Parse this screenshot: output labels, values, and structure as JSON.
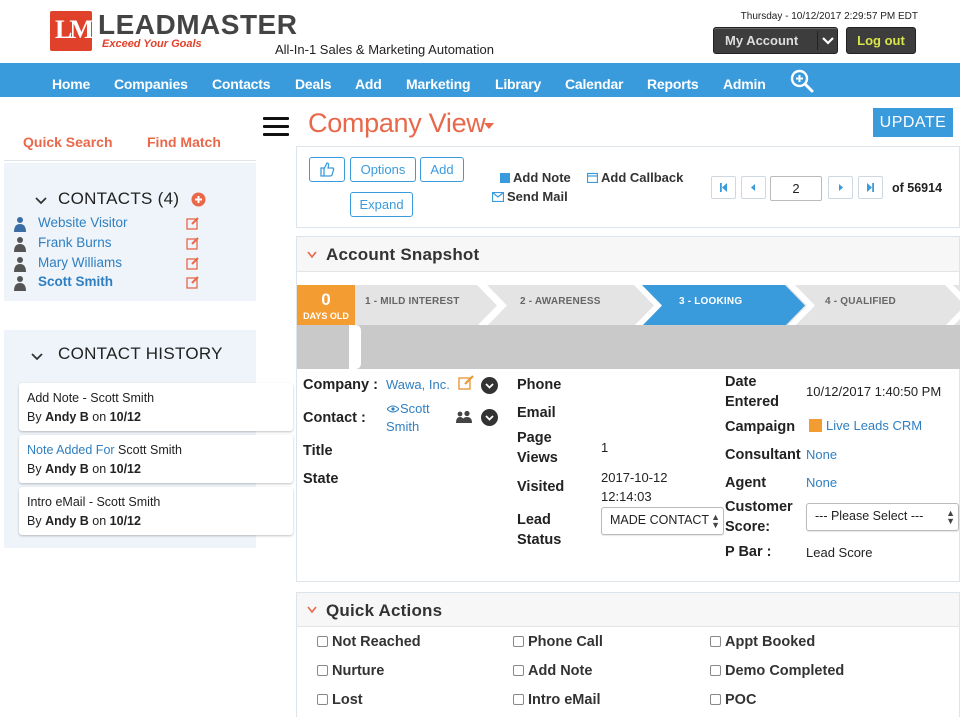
{
  "header": {
    "logo_name": "LEADMASTER",
    "logo_tagline": "Exceed Your Goals",
    "product_tagline": "All-In-1 Sales & Marketing Automation",
    "datetime": "Thursday - 10/12/2017 2:29:57 PM EDT",
    "my_account_label": "My Account",
    "logout_label": "Log out"
  },
  "nav": {
    "items": [
      "Home",
      "Companies",
      "Contacts",
      "Deals",
      "Add",
      "Marketing",
      "Library",
      "Calendar",
      "Reports",
      "Admin"
    ]
  },
  "sidebar": {
    "quick_search": "Quick Search",
    "find_match": "Find Match",
    "contacts_title": "CONTACTS (4)",
    "contacts": [
      "Website Visitor",
      "Frank Burns",
      "Mary Williams",
      "Scott Smith"
    ],
    "history_title": "CONTACT HISTORY",
    "history": [
      {
        "line1_prefix": "Add Note - Scott Smith",
        "line1_highlight": "",
        "line2_by": "By ",
        "line2_user": "Andy B",
        "line2_on": " on ",
        "line2_date": "10/12"
      },
      {
        "line1_prefix": "Scott Smith",
        "line1_highlight": "Note Added For ",
        "line2_by": "By ",
        "line2_user": "Andy B",
        "line2_on": " on ",
        "line2_date": "10/12"
      },
      {
        "line1_prefix": "Intro eMail - Scott Smith",
        "line1_highlight": "",
        "line2_by": "By ",
        "line2_user": "Andy B",
        "line2_on": " on ",
        "line2_date": "10/12"
      }
    ]
  },
  "main": {
    "title": "Company View",
    "update_label": "UPDATE",
    "toolbar": {
      "options_label": "Options",
      "add_label": "Add",
      "expand_label": "Expand",
      "add_note_label": "Add Note",
      "add_callback_label": "Add Callback",
      "send_mail_label": "Send Mail",
      "page_value": "2",
      "page_total": "of 56914"
    },
    "snapshot": {
      "title": "Account Snapshot",
      "days_count": "0",
      "days_label": "DAYS OLD",
      "stages": [
        "1 - MILD INTEREST",
        "2 - AWARENESS",
        "3 - LOOKING",
        "4 - QUALIFIED"
      ],
      "active_stage_index": 2,
      "company_label": "Company :",
      "company_value": "Wawa, Inc.",
      "contact_label": "Contact :",
      "contact_value_1": "Scott",
      "contact_value_2": "Smith",
      "title_label": "Title",
      "state_label": "State",
      "phone_label": "Phone",
      "email_label": "Email",
      "page_views_label_1": "Page",
      "page_views_label_2": "Views",
      "page_views_value": "1",
      "visited_label": "Visited",
      "visited_value_1": "2017-10-12",
      "visited_value_2": "12:14:03",
      "lead_status_label_1": "Lead",
      "lead_status_label_2": "Status",
      "lead_status_value": "MADE CONTACT",
      "date_entered_label_1": "Date",
      "date_entered_label_2": "Entered",
      "date_entered_value": "10/12/2017 1:40:50 PM",
      "campaign_label": "Campaign",
      "campaign_value": "Live Leads CRM",
      "consultant_label": "Consultant",
      "consultant_value": "None",
      "agent_label": "Agent",
      "agent_value": "None",
      "customer_score_label_1": "Customer",
      "customer_score_label_2": "Score:",
      "customer_score_value": "--- Please Select ---",
      "pbar_label": "P Bar :",
      "pbar_value": "Lead Score"
    },
    "quick_actions": {
      "title": "Quick Actions",
      "items": [
        "Not Reached",
        "Phone Call",
        "Appt Booked",
        "Nurture",
        "Add Note",
        "Demo Completed",
        "Lost",
        "Intro eMail",
        "POC"
      ]
    }
  },
  "colors": {
    "brand_red": "#e0412b",
    "accent_orange": "#e8684a",
    "nav_blue": "#3a9bdc",
    "link_blue": "#2f7fc1",
    "stage_active": "#3a9bdc",
    "days_orange": "#f39c32"
  }
}
